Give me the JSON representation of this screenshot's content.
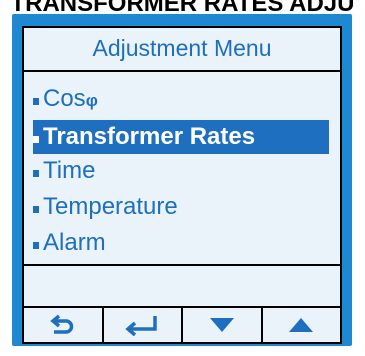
{
  "caption": "TRANSFORMER RATES ADJU",
  "menu": {
    "title": "Adjustment Menu",
    "items": [
      {
        "label": "Cos",
        "suffix": "φ",
        "selected": false
      },
      {
        "label": "Transformer Rates",
        "selected": true
      },
      {
        "label": "Time",
        "selected": false
      },
      {
        "label": "Temperature",
        "selected": false
      },
      {
        "label": "Alarm",
        "selected": false
      }
    ]
  },
  "softkeys": [
    {
      "icon": "back-arrow-icon"
    },
    {
      "icon": "enter-icon"
    },
    {
      "icon": "down-triangle-icon"
    },
    {
      "icon": "up-triangle-icon"
    }
  ],
  "colors": {
    "bezel": "#1e88d0",
    "screen_bg": "#eaf3fa",
    "text": "#1e6fbf",
    "highlight": "#1e6fbf"
  }
}
